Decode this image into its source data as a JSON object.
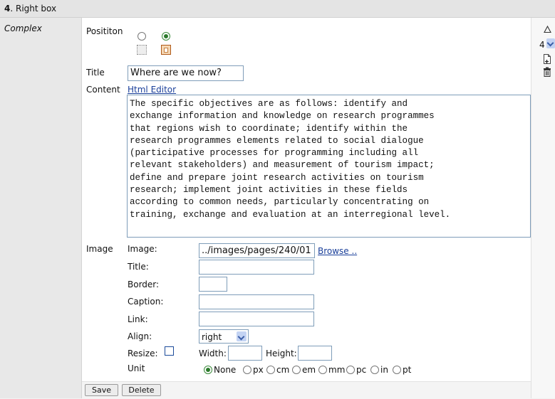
{
  "header": {
    "number": "4",
    "title": ". Right box"
  },
  "left": {
    "label": "Complex"
  },
  "position": {
    "label": "Posititon"
  },
  "title": {
    "label": "Title",
    "value": "Where are we now?"
  },
  "content": {
    "label": "Content",
    "editor_link": "Html Editor",
    "text": "The specific objectives are as follows: identify and\nexchange information and knowledge on research programmes\nthat regions wish to coordinate; identify within the\nresearch programmes elements related to social dialogue\n(participative processes for programming including all\nrelevant stakeholders) and measurement of tourism impact;\ndefine and prepare joint research activities on tourism\nresearch; implement joint activities in these fields\naccording to common needs, particularly concentrating on\ntraining, exchange and evaluation at an interregional level."
  },
  "image": {
    "section_label": "Image",
    "image_label": "Image:",
    "image_value": "../images/pages/240/01",
    "browse": "Browse ..",
    "title_label": "Title:",
    "border_label": "Border:",
    "caption_label": "Caption:",
    "link_label": "Link:",
    "align_label": "Align:",
    "align_value": "right",
    "resize_label": "Resize:",
    "width_label": "Width:",
    "height_label": "Height:",
    "unit_label": "Unit",
    "units": [
      "None",
      "px",
      "cm",
      "em",
      "mm",
      "pc",
      "in",
      "pt"
    ]
  },
  "buttons": {
    "save": "Save",
    "delete": "Delete"
  },
  "side": {
    "order_value": "4"
  }
}
